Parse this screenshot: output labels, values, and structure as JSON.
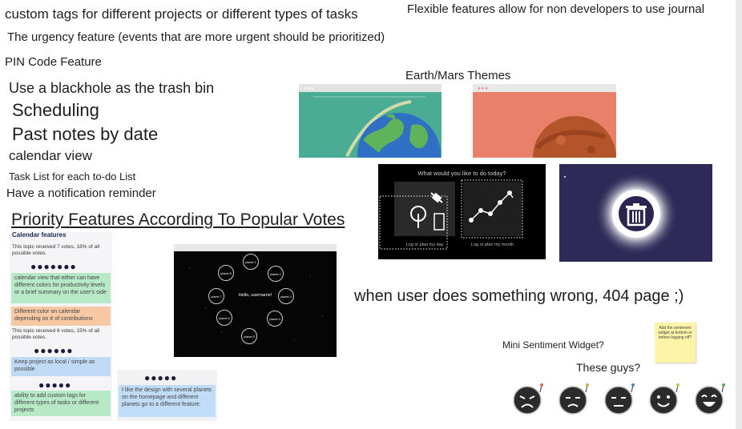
{
  "notes": {
    "custom_tags": "custom tags for different projects or different types of tasks",
    "flexible": "Flexible features allow for non developers to use journal",
    "urgency": "The urgency feature (events that are more urgent should be prioritized)",
    "pin": "PIN Code Feature",
    "blackhole": "Use a blackhole as the trash bin",
    "scheduling": "Scheduling",
    "past_notes": "Past notes by date",
    "calendar_view": "calendar view",
    "task_list": "Task List for each to-do List",
    "notification": "Have a notification reminder",
    "themes_title": "Earth/Mars Themes",
    "error_404": "when user does something wrong, 404 page ;)",
    "sentiment": "Mini Sentiment Widget?",
    "these_guys": "These guys?"
  },
  "priority_heading": "Priority Features According To Popular Votes",
  "survey": {
    "title": "Calendar features",
    "topic1": "This topic received 7 votes, 18% of all possible votes.",
    "topic2": "This topic received 6 votes, 15% of all possible votes.",
    "votes7": "●●●●●●●",
    "votes6": "●●●●●●",
    "votes5a": "●●●●●",
    "votes5b": "●●●●●",
    "sticky_calendar": "calendar view that either can have different colors for productivity levels or a brief summary on the user's side",
    "sticky_color": "Different color on calendar depending on # of contributions",
    "sticky_local": "Keep project as local / simple as possible",
    "sticky_tags": "ability to add custom tags for different types of tasks or different projects",
    "sticky_design": "I like the design with several planets on the homepage and different planets go to a different feature."
  },
  "todo_mock": {
    "question": "What would you like to do today?",
    "day_caption": "Log or plan my day",
    "month_caption": "Log or plan my month"
  },
  "planets_mock": {
    "greeting": "Hello, username!",
    "planets": [
      "planet 1",
      "planet 2",
      "planet 3",
      "planet 4",
      "planet 5",
      "planet 6",
      "planet 7",
      "planet 8"
    ]
  },
  "yellow_sticky": "Add the sentiment widget at bottom or before logging off?",
  "colors": {
    "earth_bg": "#4bac94",
    "mars_bg": "#e9806a",
    "mint_sticky": "#b7e9c6",
    "orange_sticky": "#f6c9a4",
    "blue_sticky": "#c0d9f5",
    "yellow_sticky": "#fdf4a8",
    "space_bg": "#2d2a57"
  }
}
